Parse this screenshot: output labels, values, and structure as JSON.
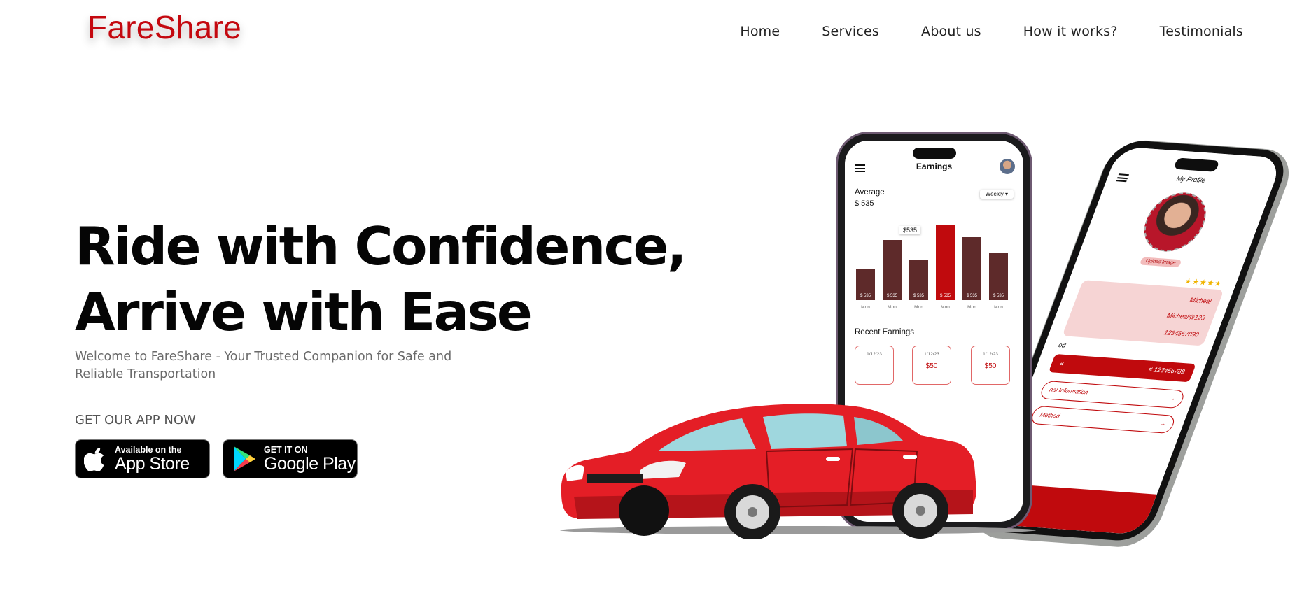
{
  "brand": {
    "name": "FareShare"
  },
  "nav": {
    "items": [
      {
        "label": "Home"
      },
      {
        "label": "Services"
      },
      {
        "label": "About us"
      },
      {
        "label": "How it works?"
      },
      {
        "label": "Testimonials"
      }
    ]
  },
  "hero": {
    "title_line1": "Ride with Confidence,",
    "title_line2": "Arrive with Ease",
    "subtitle": "Welcome to FareShare - Your Trusted Companion for Safe and Reliable Transportation",
    "cta_heading": "GET OUR APP NOW",
    "app_store": {
      "small": "Available on the",
      "big": "App Store"
    },
    "google_play": {
      "small": "GET IT ON",
      "big": "Google Play"
    }
  },
  "phone_earnings": {
    "title": "Earnings",
    "average_label": "Average",
    "average_value": "$ 535",
    "period": "Weekly",
    "tooltip": "$535",
    "bars": [
      {
        "value_label": "$ 535",
        "day": "Mon",
        "height_pct": 42,
        "highlight": false
      },
      {
        "value_label": "$ 535",
        "day": "Mon",
        "height_pct": 80,
        "highlight": false
      },
      {
        "value_label": "$ 535",
        "day": "Mon",
        "height_pct": 53,
        "highlight": false
      },
      {
        "value_label": "$ 535",
        "day": "Mon",
        "height_pct": 100,
        "highlight": true
      },
      {
        "value_label": "$ 535",
        "day": "Mon",
        "height_pct": 83,
        "highlight": false
      },
      {
        "value_label": "$ 535",
        "day": "Mon",
        "height_pct": 63,
        "highlight": false
      }
    ],
    "recent_label": "Recent Earnings",
    "recent": [
      {
        "date": "1/12/23",
        "amount": ""
      },
      {
        "date": "1/12/23",
        "amount": "$50"
      },
      {
        "date": "1/12/23",
        "amount": "$50"
      }
    ]
  },
  "phone_profile": {
    "title": "My Profile",
    "upload_label": "Upload Image",
    "stars": "★★★★★",
    "fields": [
      "Micheal",
      "Micheal@123",
      "1234567890"
    ],
    "section_partial": "od",
    "card_number": "#   123456789",
    "card_partial": "a",
    "buttons": [
      "nal Information",
      "Method"
    ]
  },
  "colors": {
    "brand_red": "#c4080f",
    "bar_dark": "#5e2a2a",
    "bar_highlight": "#c00a0d"
  }
}
